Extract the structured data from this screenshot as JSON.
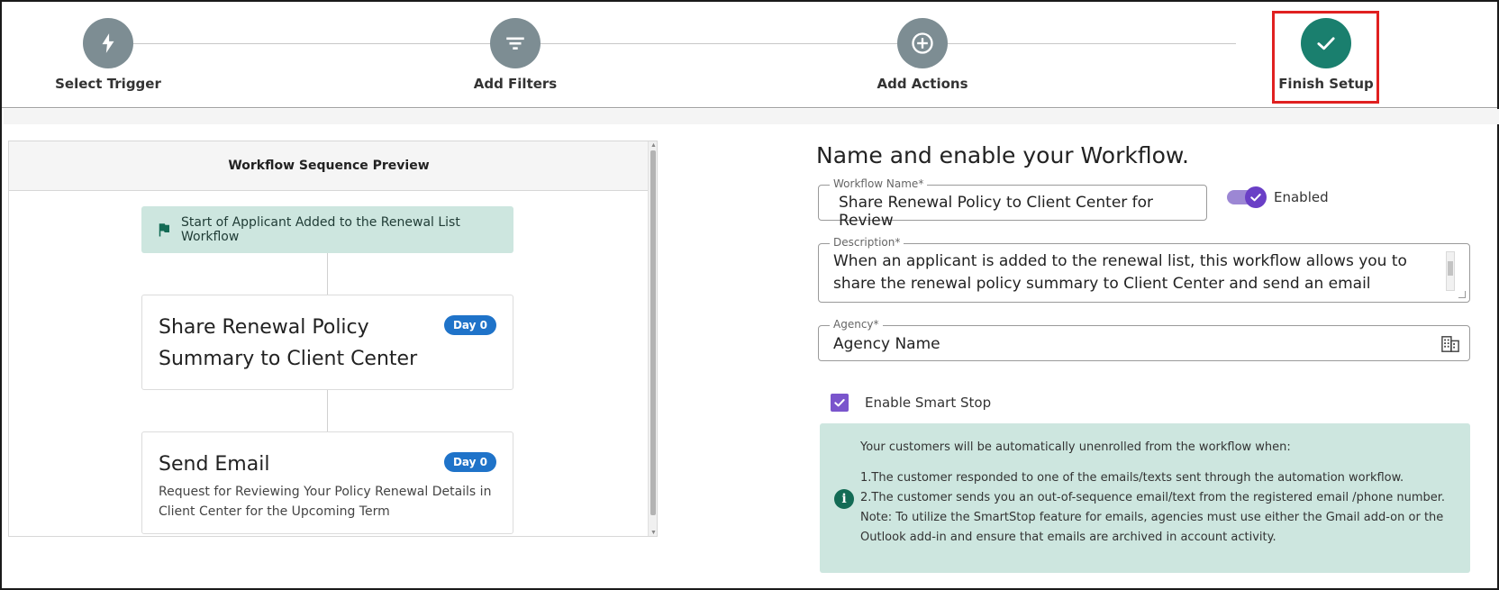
{
  "stepper": {
    "steps": [
      {
        "label": "Select Trigger",
        "icon": "lightning-icon",
        "state": "complete"
      },
      {
        "label": "Add Filters",
        "icon": "filter-icon",
        "state": "complete"
      },
      {
        "label": "Add Actions",
        "icon": "plus-circle-icon",
        "state": "complete"
      },
      {
        "label": "Finish Setup",
        "icon": "check-icon",
        "state": "active"
      }
    ],
    "highlight_color": "#e02020"
  },
  "preview": {
    "header": "Workflow Sequence Preview",
    "start_node": "Start of Applicant Added to the Renewal List Workflow",
    "actions": [
      {
        "title": "Share Renewal Policy Summary to Client Center",
        "badge": "Day 0",
        "description": ""
      },
      {
        "title": "Send Email",
        "badge": "Day 0",
        "description": "Request for Reviewing Your Policy Renewal Details in Client Center for the Upcoming Term"
      }
    ]
  },
  "form": {
    "title": "Name and enable your Workflow.",
    "workflow_name": {
      "label": "Workflow Name*",
      "value": "Share Renewal Policy to Client Center for Review"
    },
    "enabled_toggle": {
      "label": "Enabled",
      "checked": true
    },
    "description": {
      "label": "Description*",
      "value": "When an applicant is added to the renewal list, this workflow allows you to share the renewal policy summary to Client Center and send an email notification to the"
    },
    "agency": {
      "label": "Agency*",
      "value": "Agency Name"
    },
    "smart_stop": {
      "label": "Enable Smart Stop",
      "checked": true
    },
    "info": {
      "intro": "Your customers will be automatically unenrolled from the workflow when:",
      "line1": "1.The customer responded to one of the emails/texts sent through the automation workflow.",
      "line2": "2.The customer sends you an out-of-sequence email/text from the registered email /phone number.",
      "note": "Note: To utilize the SmartStop feature for emails, agencies must use either the Gmail add-on or the Outlook add-in and ensure that emails are archived in account activity."
    }
  },
  "colors": {
    "step_inactive": "#7d8d93",
    "step_done": "#1a7f6e",
    "accent_purple": "#6a3fc6",
    "badge_blue": "#1f73c9",
    "mint_bg": "#cde6df"
  }
}
